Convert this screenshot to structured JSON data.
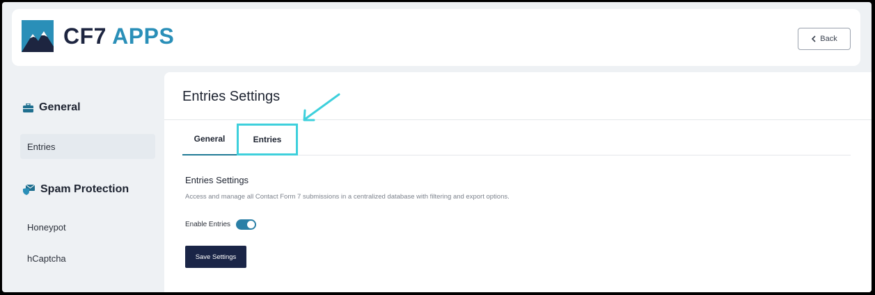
{
  "header": {
    "brand_part1": "CF7",
    "brand_part2": "APPS",
    "back_label": "Back"
  },
  "sidebar": {
    "general_heading": "General",
    "general_items": [
      {
        "label": "Entries",
        "active": true
      }
    ],
    "spam_heading": "Spam Protection",
    "spam_items": [
      {
        "label": "Honeypot"
      },
      {
        "label": "hCaptcha"
      }
    ]
  },
  "main": {
    "title": "Entries Settings",
    "tabs": [
      {
        "label": "General",
        "active": true
      },
      {
        "label": "Entries",
        "highlighted": true
      }
    ],
    "section_title": "Entries Settings",
    "section_desc": "Access and manage all Contact Form 7 submissions in a centralized database with filtering and export options.",
    "toggle_label": "Enable Entries",
    "toggle_on": true,
    "save_label": "Save Settings"
  },
  "colors": {
    "accent": "#2a8fb8",
    "brand_dark": "#1d2540",
    "button_bg": "#1a2547",
    "highlight": "#3ed0dc"
  },
  "icons": {
    "logo": "mountain-logo-icon",
    "back": "chevron-left-icon",
    "general": "briefcase-icon",
    "spam": "mail-shield-icon",
    "annotation": "arrow-annotation-icon"
  }
}
